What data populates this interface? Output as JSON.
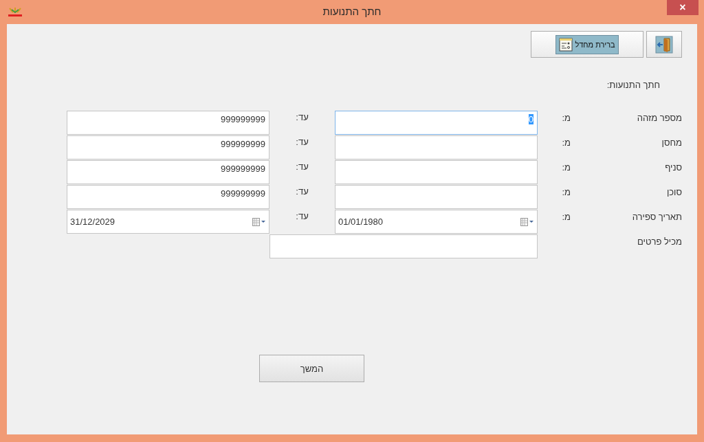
{
  "window": {
    "title": "חתך התנועות",
    "close": "×"
  },
  "toolbar": {
    "default_button": "ברירת מחדל"
  },
  "section_title": "חתך התנועות:",
  "rows": [
    {
      "label": "מספר מזהה",
      "from_label": "מ:",
      "from": {
        "kind": "text",
        "value": "0",
        "focused": true
      },
      "to_label": "עד:",
      "to": {
        "kind": "text",
        "value": "999999999",
        "focused": false
      }
    },
    {
      "label": "מחסן",
      "from_label": "מ:",
      "from": {
        "kind": "text",
        "focused": false
      },
      "to_label": "עד:",
      "to": {
        "kind": "text",
        "value": "999999999",
        "focused": false
      }
    },
    {
      "label": "סניף",
      "from_label": "מ:",
      "from": {
        "kind": "text",
        "focused": false
      },
      "to_label": "עד:",
      "to": {
        "kind": "text",
        "value": "999999999",
        "focused": false
      }
    },
    {
      "label": "סוכן",
      "from_label": "מ:",
      "from": {
        "kind": "text",
        "focused": false
      },
      "to_label": "עד:",
      "to": {
        "kind": "text",
        "value": "999999999",
        "focused": false
      }
    },
    {
      "label": "תאריך ספירה",
      "from_label": "מ:",
      "from": {
        "kind": "date",
        "value": "01/01/1980",
        "focused": false
      },
      "to_label": "עד:",
      "to": {
        "kind": "date",
        "value": "31/12/2029",
        "focused": false
      }
    }
  ],
  "contains": {
    "label": "מכיל פרטים"
  },
  "continue_button": "המשך"
}
